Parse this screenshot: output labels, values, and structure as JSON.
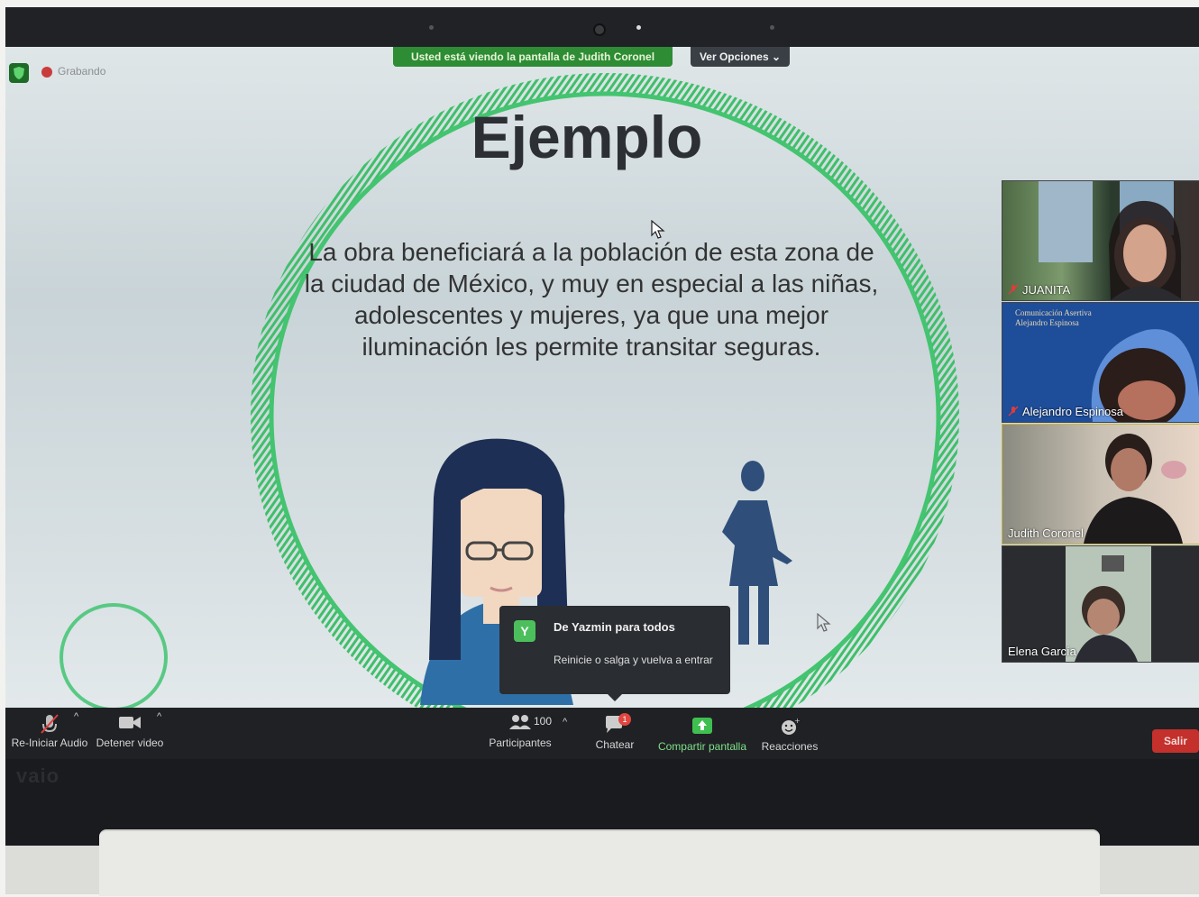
{
  "banner": {
    "share_text": "Usted está viendo la pantalla de Judith Coronel",
    "view_options": "Ver Opciones"
  },
  "recording": {
    "label": "Grabando"
  },
  "slide": {
    "title": "Ejemplo",
    "body": "La obra beneficiará a la población de esta zona de la ciudad de México, y muy en especial a las niñas, adolescentes y mujeres, ya que  una mejor iluminación les permite transitar seguras."
  },
  "chat_popup": {
    "avatar_letter": "Y",
    "from": "De Yazmin para todos",
    "message": "Reinicie o salga y vuelva a entrar"
  },
  "participants": [
    {
      "name": "JUANITA",
      "muted": true
    },
    {
      "name": "Alejandro Espinosa",
      "muted": true,
      "overlay": "Comunicación Asertiva\nAlejandro Espinosa"
    },
    {
      "name": "Judith Coronel",
      "muted": false
    },
    {
      "name": "Elena García",
      "muted": false
    }
  ],
  "toolbar": {
    "audio_label": "Re-Iniciar Audio",
    "video_label": "Detener video",
    "participants_count": "100",
    "participants_label": "Participantes",
    "chat_label": "Chatear",
    "chat_badge": "1",
    "share_label": "Compartir pantalla",
    "reactions_label": "Reacciones",
    "leave_label": "Salir"
  },
  "laptop": {
    "brand": "vaio"
  },
  "colors": {
    "share_green": "#2d8c34",
    "accent_green": "#4cbf5c",
    "leave_red": "#c4302b",
    "ring_green": "#3fbf6a"
  }
}
